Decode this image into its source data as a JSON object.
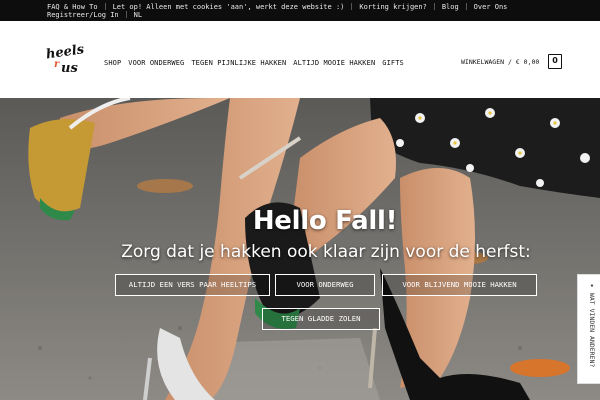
{
  "topbar": {
    "row1": [
      "FAQ & How To",
      "Let op! Alleen met cookies 'aan', werkt deze website :)",
      "Korting krijgen?",
      "Blog",
      "Over Ons"
    ],
    "row2": [
      "Registreer/Log In",
      "NL"
    ]
  },
  "logo": {
    "line1": "heels",
    "line2": "r",
    "line3": "us"
  },
  "nav": {
    "items": [
      "SHOP",
      "VOOR ONDERWEG",
      "TEGEN PIJNLIJKE HAKKEN",
      "ALTIJD MOOIE HAKKEN",
      "GIFTS"
    ]
  },
  "cart": {
    "label": "WINKELWAGEN / € 0,00",
    "count": "0"
  },
  "hero": {
    "title": "Hello Fall!",
    "subtitle": "Zorg dat je hakken ook klaar zijn voor de herfst:",
    "buttons": [
      "ALTIJD EEN VERS PAAR HEELTIPS",
      "VOOR ONDERWEG",
      "VOOR BLIJVEND MOOIE HAKKEN",
      "TEGEN GLADDE ZOLEN"
    ]
  },
  "side_tab": {
    "label": "WAT VINDEN ANDEREN?",
    "icon": "star-icon"
  },
  "colors": {
    "topbar_bg": "#0d0d0d",
    "logo_accent": "#e8552f",
    "text_dark": "#111111"
  }
}
